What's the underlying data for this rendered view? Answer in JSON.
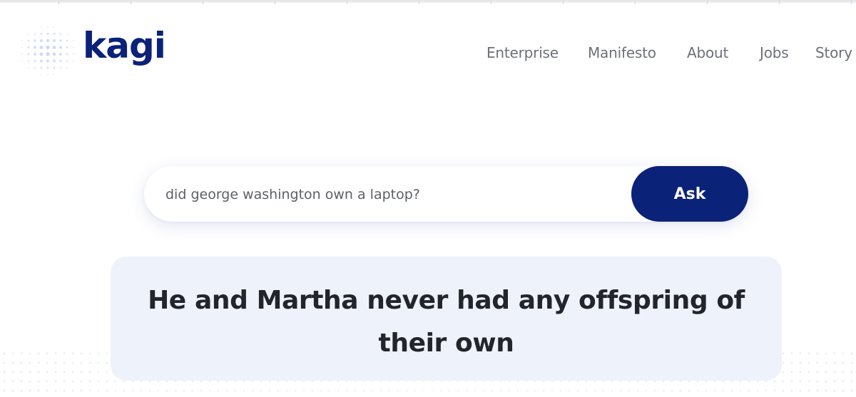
{
  "header": {
    "logo": {
      "text": "kagi",
      "icon": "kagi-dots-logo-icon",
      "color": "#0b2279",
      "dot_color": "#c9d4f2"
    },
    "nav": [
      {
        "label": "Enterprise"
      },
      {
        "label": "Manifesto"
      },
      {
        "label": "About"
      },
      {
        "label": "Jobs"
      },
      {
        "label": "Story"
      }
    ]
  },
  "search": {
    "value": "did george washington own a laptop?",
    "button_label": "Ask",
    "button_color": "#0b2279"
  },
  "answer": {
    "text": "He and Martha never had any offspring of their own",
    "background": "#eef2fb"
  }
}
